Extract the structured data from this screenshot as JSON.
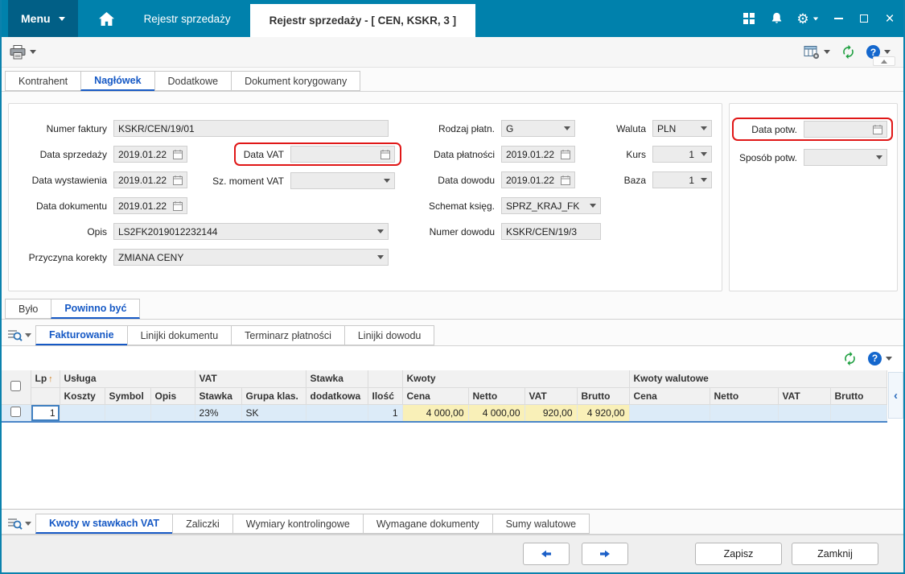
{
  "colors": {
    "titlebar": "#0081ac",
    "accent_blue": "#1659c5",
    "highlight_red": "#e01717",
    "row_selected": "#dcebf8",
    "cell_yellow": "#f9f0b8",
    "refresh_green": "#1d9f3f"
  },
  "titlebar": {
    "menu_label": "Menu",
    "tab_inactive": "Rejestr sprzedaży",
    "tab_active": "Rejestr sprzedaży - [ CEN, KSKR, 3 ]"
  },
  "main_tabs": {
    "kontrahent": "Kontrahent",
    "naglowek": "Nagłówek",
    "dodatkowe": "Dodatkowe",
    "dokument_korygowany": "Dokument korygowany"
  },
  "form": {
    "numer_faktury": {
      "label": "Numer faktury",
      "value": "KSKR/CEN/19/01"
    },
    "data_sprzedazy": {
      "label": "Data sprzedaży",
      "value": "2019.01.22"
    },
    "data_wystawienia": {
      "label": "Data wystawienia",
      "value": "2019.01.22"
    },
    "data_dokumentu": {
      "label": "Data dokumentu",
      "value": "2019.01.22"
    },
    "opis": {
      "label": "Opis",
      "value": "LS2FK2019012232144"
    },
    "przyczyna_korekty": {
      "label": "Przyczyna korekty",
      "value": "ZMIANA CENY"
    },
    "data_vat": {
      "label": "Data VAT",
      "value": ""
    },
    "sz_moment_vat": {
      "label": "Sz. moment VAT",
      "value": ""
    },
    "rodzaj_platn": {
      "label": "Rodzaj płatn.",
      "value": "G"
    },
    "data_platnosci": {
      "label": "Data płatności",
      "value": "2019.01.22"
    },
    "data_dowodu": {
      "label": "Data dowodu",
      "value": "2019.01.22"
    },
    "schemat_ksieg": {
      "label": "Schemat księg.",
      "value": "SPRZ_KRAJ_FK"
    },
    "numer_dowodu": {
      "label": "Numer dowodu",
      "value": "KSKR/CEN/19/3"
    },
    "waluta": {
      "label": "Waluta",
      "value": "PLN"
    },
    "kurs": {
      "label": "Kurs",
      "value": "1"
    },
    "baza": {
      "label": "Baza",
      "value": "1"
    },
    "data_potw": {
      "label": "Data potw.",
      "value": ""
    },
    "sposob_potw": {
      "label": "Sposób potw.",
      "value": ""
    }
  },
  "mid_tabs": {
    "bylo": "Było",
    "powinno_byc": "Powinno być"
  },
  "detail_tabs": {
    "fakturowanie": "Fakturowanie",
    "linijki_dokumentu": "Linijki dokumentu",
    "terminarz_platnosci": "Terminarz płatności",
    "linijki_dowodu": "Linijki dowodu"
  },
  "grid": {
    "header": {
      "lp": "Lp",
      "lp_sort": "↑",
      "usluga": "Usługa",
      "vat": "VAT",
      "stawka_line1": "Stawka",
      "stawka_line2": "dodatkowa",
      "kwoty": "Kwoty",
      "kwoty_walutowe": "Kwoty walutowe",
      "koszty": "Koszty",
      "symbol": "Symbol",
      "opis": "Opis",
      "stawka": "Stawka",
      "grupa_klas": "Grupa klas.",
      "ilosc": "Ilość",
      "cena": "Cena",
      "netto": "Netto",
      "vat2": "VAT",
      "brutto": "Brutto",
      "cena_w": "Cena",
      "netto_w": "Netto",
      "vat_w": "VAT",
      "brutto_w": "Brutto"
    },
    "row": {
      "lp": "1",
      "stawka": "23%",
      "grupa_klas": "SK",
      "ilosc": "1",
      "cena": "4 000,00",
      "netto": "4 000,00",
      "vat": "920,00",
      "brutto": "4 920,00"
    }
  },
  "bottom_tabs": {
    "kwoty_vat": "Kwoty w stawkach VAT",
    "zaliczki": "Zaliczki",
    "wymiary": "Wymiary kontrolingowe",
    "wymagane": "Wymagane dokumenty",
    "sumy": "Sumy walutowe"
  },
  "footer": {
    "zapisz": "Zapisz",
    "zamknij": "Zamknij"
  },
  "icons": {
    "gear": "⚙",
    "close": "×",
    "help": "?",
    "collapse_left": "‹"
  }
}
